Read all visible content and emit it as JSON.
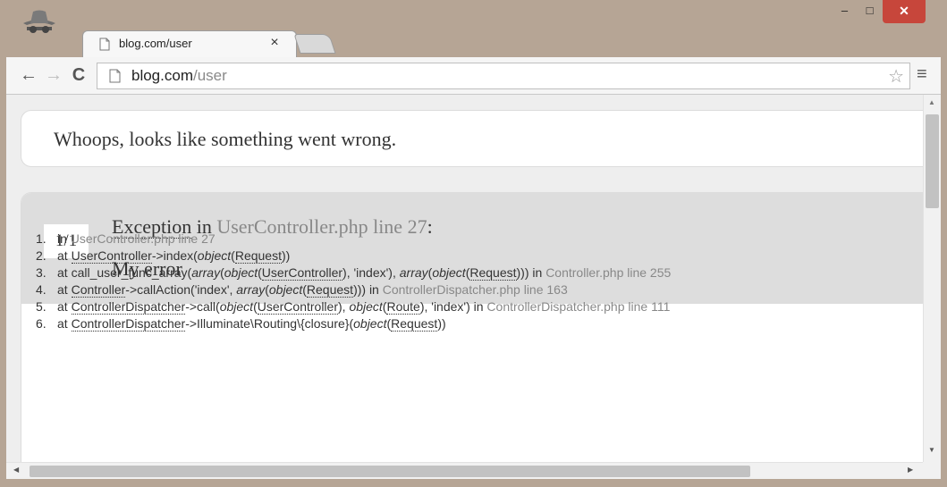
{
  "browser": {
    "tab_title": "blog.com/user",
    "tab_close": "×",
    "url_host": "blog.com",
    "url_path": "/user",
    "back_icon": "←",
    "forward_icon": "→",
    "reload_icon": "C",
    "star_icon": "☆",
    "menu_icon": "≡",
    "min_icon": "–",
    "max_icon": "□",
    "close_icon": "✕"
  },
  "page": {
    "headline": "Whoops, looks like something went wrong.",
    "counter": "1/1",
    "exception_type": "Exception",
    "exception_in": " in ",
    "exception_file": "UserController.php line 27",
    "exception_colon": ":",
    "message": "My error"
  },
  "trace": [
    {
      "num": "1.",
      "parts": [
        {
          "t": "in "
        },
        {
          "t": "UserController.php line 27",
          "c": "f"
        }
      ]
    },
    {
      "num": "2.",
      "parts": [
        {
          "t": "at "
        },
        {
          "t": "UserController",
          "c": "cls"
        },
        {
          "t": "->index("
        },
        {
          "t": "object",
          "c": "i"
        },
        {
          "t": "("
        },
        {
          "t": "Request",
          "c": "cls"
        },
        {
          "t": "))"
        }
      ]
    },
    {
      "num": "3.",
      "parts": [
        {
          "t": "at call_user_func_array("
        },
        {
          "t": "array",
          "c": "i"
        },
        {
          "t": "("
        },
        {
          "t": "object",
          "c": "i"
        },
        {
          "t": "("
        },
        {
          "t": "UserController",
          "c": "cls"
        },
        {
          "t": "), 'index'), "
        },
        {
          "t": "array",
          "c": "i"
        },
        {
          "t": "("
        },
        {
          "t": "object",
          "c": "i"
        },
        {
          "t": "("
        },
        {
          "t": "Request",
          "c": "cls"
        },
        {
          "t": "))) in "
        },
        {
          "t": "Controller.php line 255",
          "c": "f"
        }
      ]
    },
    {
      "num": "4.",
      "parts": [
        {
          "t": "at "
        },
        {
          "t": "Controller",
          "c": "cls"
        },
        {
          "t": "->callAction('index', "
        },
        {
          "t": "array",
          "c": "i"
        },
        {
          "t": "("
        },
        {
          "t": "object",
          "c": "i"
        },
        {
          "t": "("
        },
        {
          "t": "Request",
          "c": "cls"
        },
        {
          "t": "))) in "
        },
        {
          "t": "ControllerDispatcher.php line 163",
          "c": "f"
        }
      ]
    },
    {
      "num": "5.",
      "parts": [
        {
          "t": "at "
        },
        {
          "t": "ControllerDispatcher",
          "c": "cls"
        },
        {
          "t": "->call("
        },
        {
          "t": "object",
          "c": "i"
        },
        {
          "t": "("
        },
        {
          "t": "UserController",
          "c": "cls"
        },
        {
          "t": "), "
        },
        {
          "t": "object",
          "c": "i"
        },
        {
          "t": "("
        },
        {
          "t": "Route",
          "c": "cls"
        },
        {
          "t": "), 'index') in "
        },
        {
          "t": "ControllerDispatcher.php line 111",
          "c": "f"
        }
      ]
    },
    {
      "num": "6.",
      "parts": [
        {
          "t": "at "
        },
        {
          "t": "ControllerDispatcher",
          "c": "cls"
        },
        {
          "t": "->Illuminate\\Routing\\{closure}("
        },
        {
          "t": "object",
          "c": "i"
        },
        {
          "t": "("
        },
        {
          "t": "Request",
          "c": "cls"
        },
        {
          "t": "))"
        }
      ]
    }
  ],
  "colors": {
    "frame": "#b6a595",
    "close_button": "#c7463b",
    "header_band": "#dddddd",
    "muted_text": "#888888"
  }
}
